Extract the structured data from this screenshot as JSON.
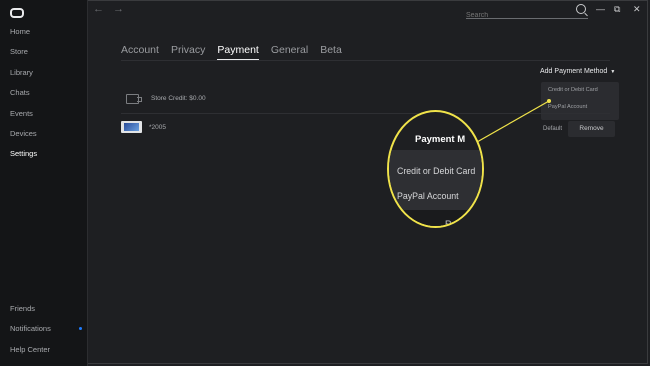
{
  "sidebar": {
    "items": [
      {
        "label": "Home"
      },
      {
        "label": "Store"
      },
      {
        "label": "Library"
      },
      {
        "label": "Chats"
      },
      {
        "label": "Events"
      },
      {
        "label": "Devices"
      },
      {
        "label": "Settings"
      }
    ],
    "bottom_items": [
      {
        "label": "Friends"
      },
      {
        "label": "Notifications"
      },
      {
        "label": "Help Center"
      }
    ]
  },
  "topbar": {
    "search_placeholder": "Search",
    "back_icon": "←",
    "forward_icon": "→",
    "minimize_icon": "—",
    "restore_icon": "⧉",
    "close_icon": "✕"
  },
  "tabs": [
    {
      "label": "Account"
    },
    {
      "label": "Privacy"
    },
    {
      "label": "Payment"
    },
    {
      "label": "General"
    },
    {
      "label": "Beta"
    }
  ],
  "payment": {
    "add_method_label": "Add Payment Method",
    "caret": "▼",
    "dropdown": [
      "Credit or Debit Card",
      "PayPal Account"
    ],
    "store_credit": "Store Credit: $0.00",
    "card_number": "*2005",
    "default_label": "Default",
    "remove_label": "Remove"
  },
  "magnifier": {
    "header": "Payment M",
    "items": [
      "Credit or Debit Card",
      "PayPal Account"
    ],
    "partial": "Re"
  },
  "colors": {
    "accent_highlight": "#f0e34a",
    "notification_dot": "#1e7bff",
    "background": "#1e1f22",
    "sidebar": "#141517"
  }
}
